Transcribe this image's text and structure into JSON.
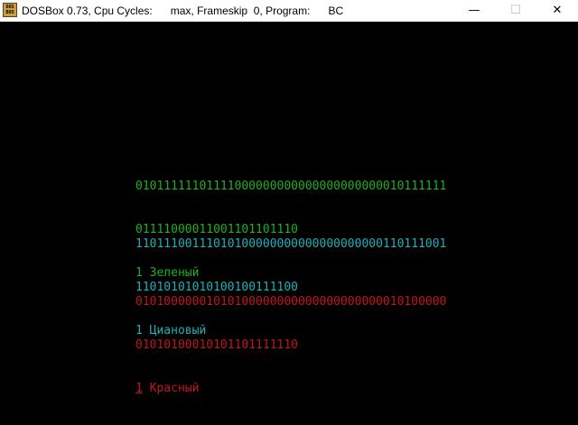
{
  "window": {
    "title": "DOSBox 0.73, Cpu Cycles:      max, Frameskip  0, Program:      BC",
    "icon_text_line1": "DOS",
    "icon_text_line2": "BOX",
    "icon": "dosbox-icon",
    "controls": {
      "minimize": "—",
      "maximize": "☐",
      "close": "✕"
    }
  },
  "console": {
    "blocks": [
      {
        "color": "#20b020",
        "line1": "01011111101111000000000000000000000010111111",
        "line2": "01111000011001101101110",
        "label": "1 Зеленый"
      },
      {
        "color": "#20b0b8",
        "line1": "11011100111010100000000000000000000110111001",
        "line2": "11010101010100100111100",
        "label": "1 Циановый"
      },
      {
        "color": "#c01818",
        "line1": "01010000001010100000000000000000000010100000",
        "line2": "01010100010101101111110",
        "label_num": "1",
        "label_rest": " Красный"
      }
    ]
  }
}
